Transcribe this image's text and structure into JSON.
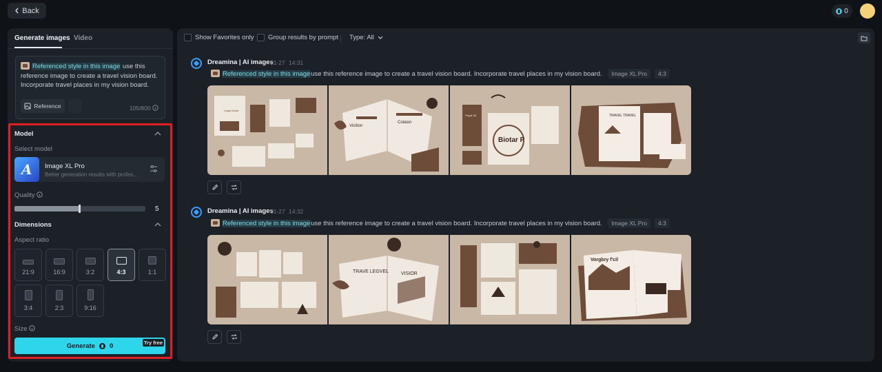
{
  "topbar": {
    "back_label": "Back",
    "credits": "0"
  },
  "left_panel": {
    "tabs": [
      {
        "label": "Generate images",
        "active": true
      },
      {
        "label": "Video",
        "active": false
      }
    ],
    "prompt": {
      "ref_chip": "Referenced style in this image",
      "text": " use this reference image to create a travel vision board. Incorporate travel places in my vision board.",
      "reference_button": "Reference",
      "char_count": "105/800"
    },
    "model_section": {
      "title": "Model",
      "select_label": "Select model",
      "model_name": "Image XL Pro",
      "model_desc": "Better generation results with profes..."
    },
    "quality": {
      "label": "Quality",
      "value": "5",
      "level": 0.5
    },
    "dimensions": {
      "title": "Dimensions",
      "aspect_label": "Aspect ratio",
      "ratios": [
        "21:9",
        "16:9",
        "3:2",
        "4:3",
        "1:1",
        "3:4",
        "2:3",
        "9:16"
      ],
      "selected": "4:3"
    },
    "size_label": "Size",
    "generate": {
      "label": "Generate",
      "cost": "0",
      "badge": "Try free"
    }
  },
  "main_panel": {
    "filters": {
      "favorites": "Show Favorites only",
      "group": "Group results by prompt",
      "type": "Type: All"
    },
    "generations": [
      {
        "title": "Dreamina | AI images",
        "date": "01-27",
        "time": "14:31",
        "ref_chip": "Referenced style in this image",
        "prompt": "use this reference image to create a travel vision board. Incorporate travel places in my vision board.",
        "model_tag": "Image XL Pro",
        "ratio_tag": "4:3",
        "images": [
          {
            "texts": [
              "Legal Guide",
              ""
            ]
          },
          {
            "texts": [
              "Vicition",
              "Colaion"
            ]
          },
          {
            "texts": [
              "Biotar P",
              "Pepat 30"
            ]
          },
          {
            "texts": [
              "TRAVEL TRAVEL",
              ""
            ]
          }
        ]
      },
      {
        "title": "Dreamina | AI images",
        "date": "01-27",
        "time": "14:32",
        "ref_chip": "Referenced style in this image",
        "prompt": "use this reference image to create a travel vision board. Incorporate travel places in my vision board.",
        "model_tag": "Image XL Pro",
        "ratio_tag": "4:3",
        "images": [
          {
            "texts": [
              "",
              ""
            ]
          },
          {
            "texts": [
              "TRAVE LEGVEL",
              "VISIOR"
            ]
          },
          {
            "texts": [
              "",
              ""
            ]
          },
          {
            "texts": [
              "Vorgbry f'cil",
              ""
            ]
          }
        ]
      }
    ]
  },
  "colors": {
    "accent": "#2ed6ec",
    "highlight": "#e01f25",
    "panel": "#1c2128",
    "background": "#0f1216",
    "board_bg": "#c9b8a6",
    "board_brown": "#6e4c3a"
  }
}
